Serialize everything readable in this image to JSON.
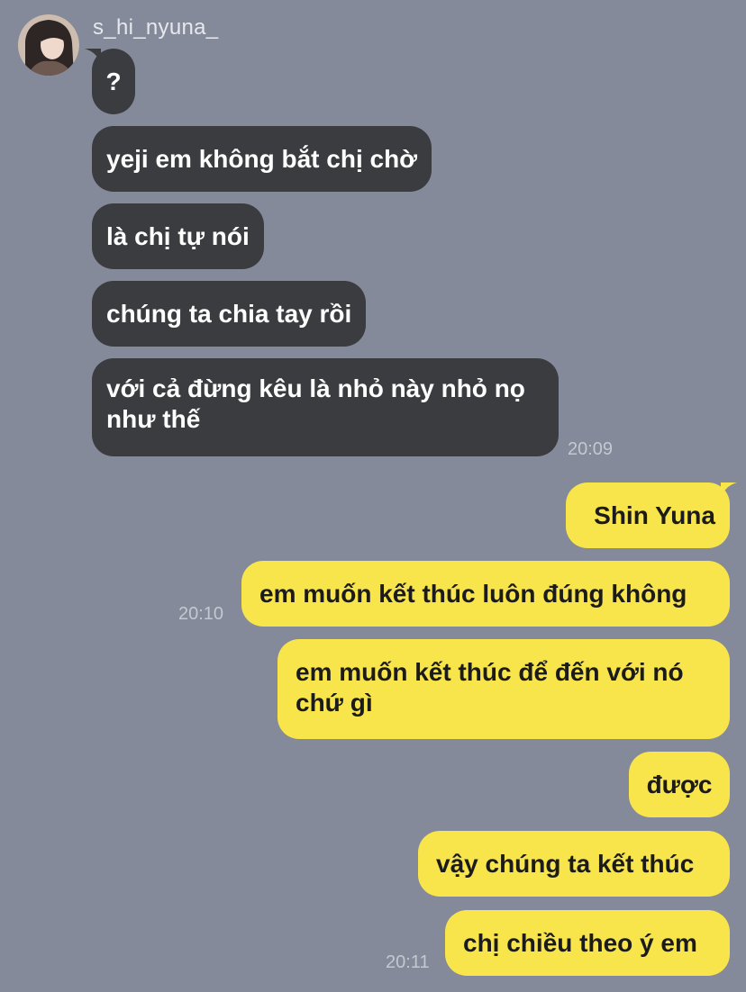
{
  "contact": {
    "username": "s_hi_nyuna_",
    "avatar_icon": "profile-photo-avatar"
  },
  "colors": {
    "background": "#848a99",
    "incoming_bubble": "#3b3c40",
    "outgoing_bubble": "#f8e44b"
  },
  "messages": [
    {
      "side": "in",
      "text": "?"
    },
    {
      "side": "in",
      "text": "yeji em không bắt chị chờ"
    },
    {
      "side": "in",
      "text": "là chị tự nói"
    },
    {
      "side": "in",
      "text": "chúng ta chia tay rồi"
    },
    {
      "side": "in",
      "text": "với cả đừng kêu là nhỏ này nhỏ nọ như thế",
      "time": "20:09"
    },
    {
      "side": "out",
      "text": "Shin Yuna"
    },
    {
      "side": "out",
      "text": "em muốn kết thúc luôn đúng không",
      "time": "20:10"
    },
    {
      "side": "out",
      "text": "em muốn kết thúc để đến với nó chứ gì"
    },
    {
      "side": "out",
      "text": "được"
    },
    {
      "side": "out",
      "text": "vậy chúng ta kết thúc"
    },
    {
      "side": "out",
      "text": "chị chiều theo ý em",
      "time": "20:11"
    }
  ]
}
